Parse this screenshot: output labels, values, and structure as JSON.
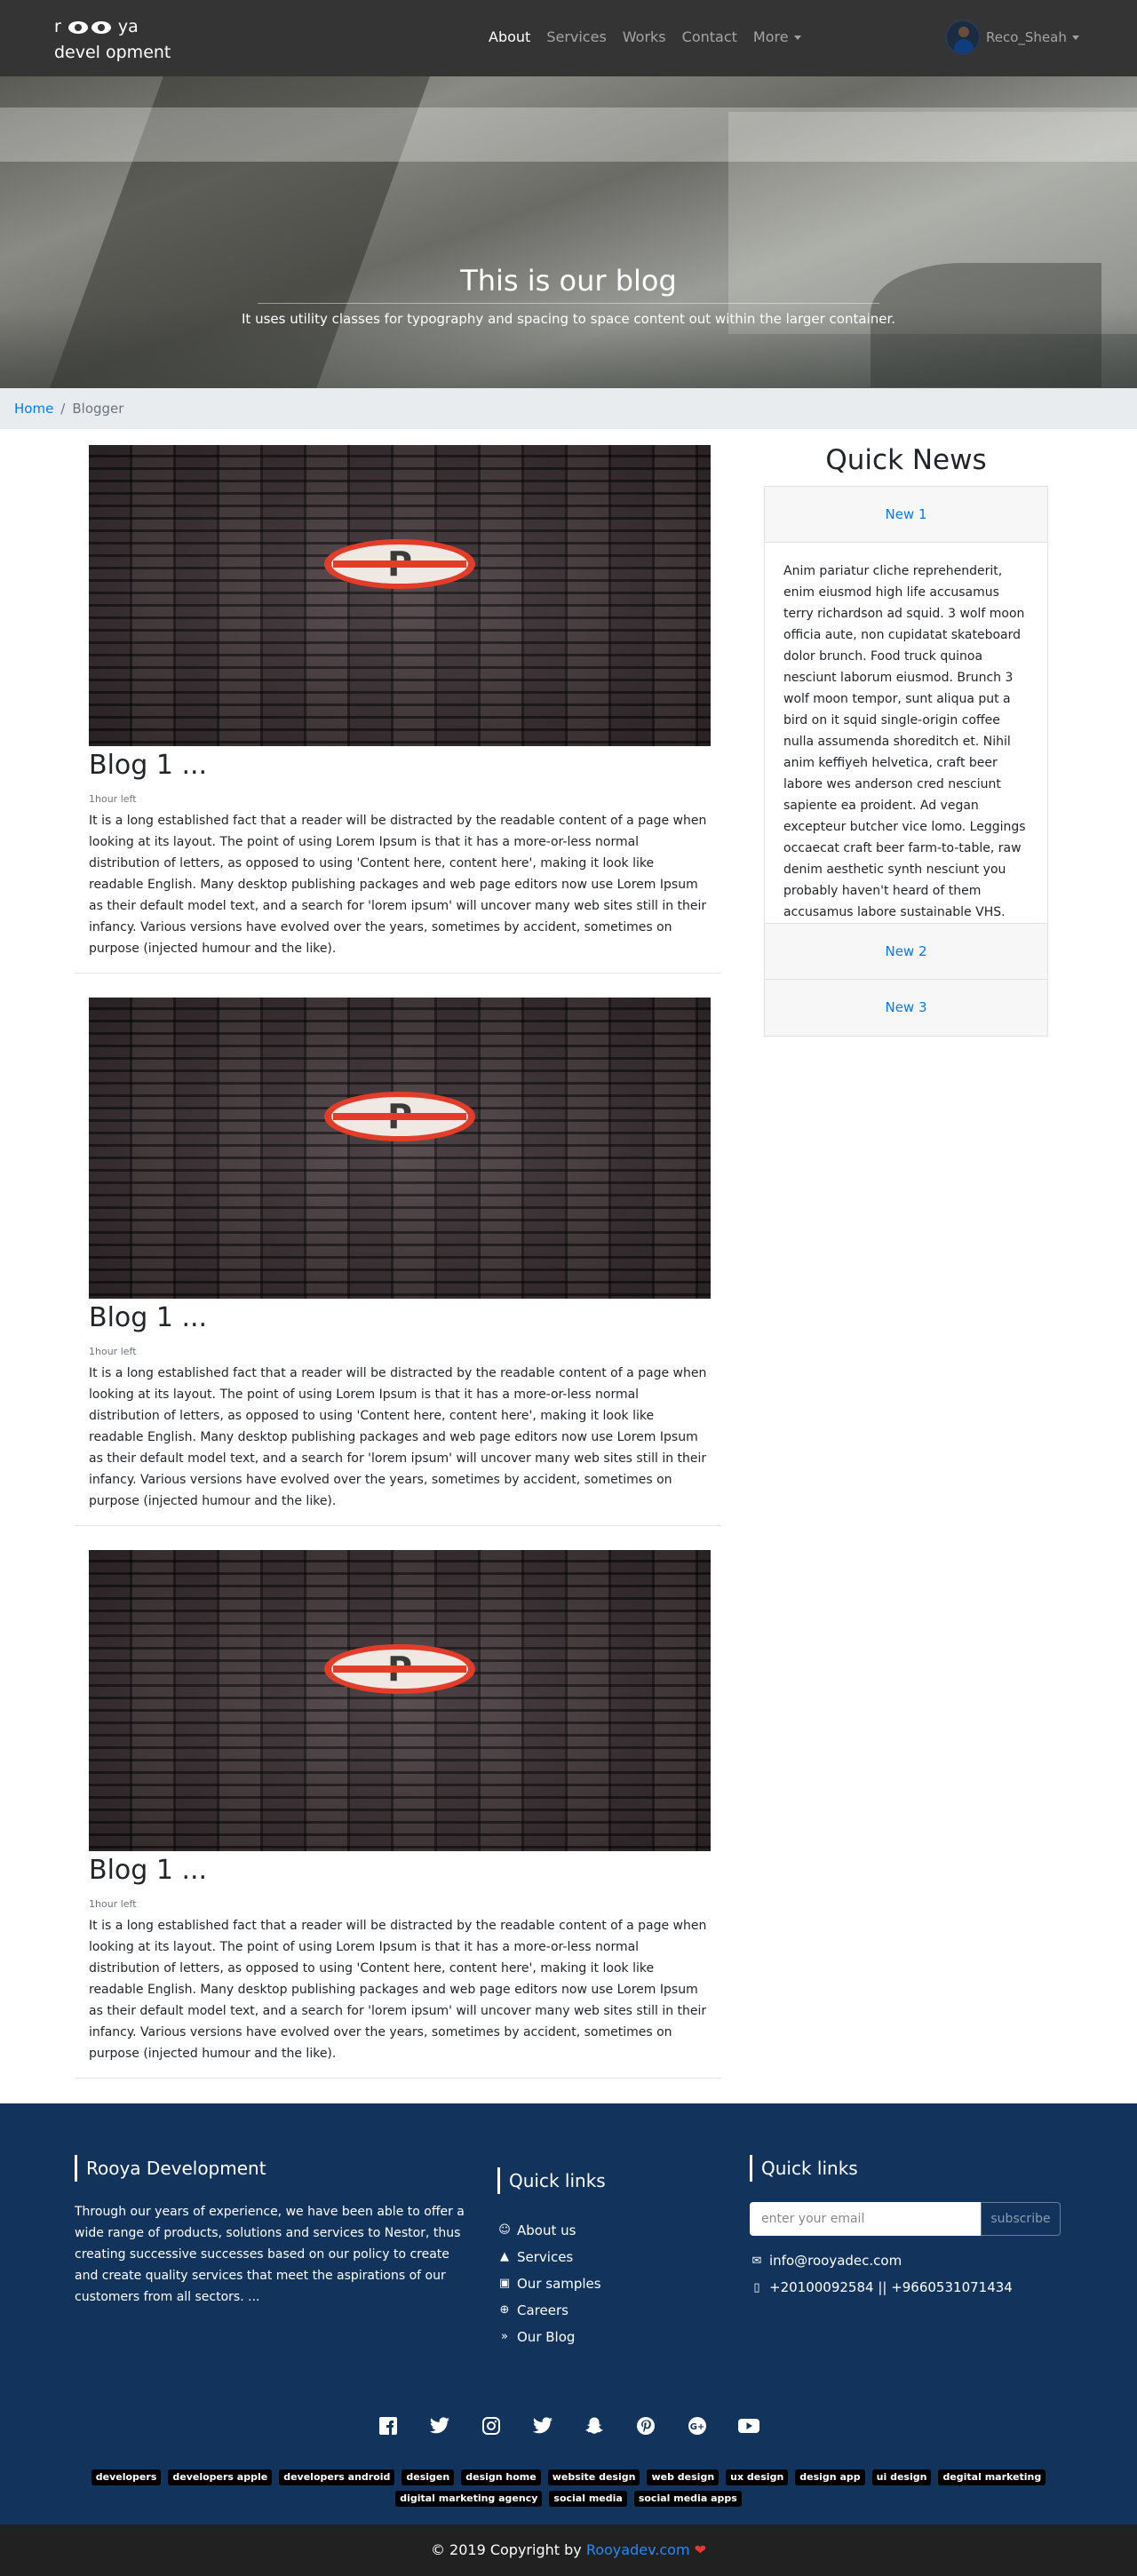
{
  "brand": {
    "line1_a": "r",
    "line1_b": "ya",
    "line2": "devel opment"
  },
  "nav": {
    "items": [
      {
        "label": "About"
      },
      {
        "label": "Services"
      },
      {
        "label": "Works"
      },
      {
        "label": "Contact"
      },
      {
        "label": "More"
      }
    ],
    "user_name": "Reco_Sheah"
  },
  "hero": {
    "title": "This is our blog",
    "subtitle": "It uses utility classes for typography and spacing to space content out within the larger container."
  },
  "breadcrumb": {
    "home": "Home",
    "separator": "/",
    "current": "Blogger"
  },
  "posts": [
    {
      "title": "Blog 1 ...",
      "time": "1hour left",
      "text": "It is a long established fact that a reader will be distracted by the readable content of a page when looking at its layout. The point of using Lorem Ipsum is that it has a more-or-less normal distribution of letters, as opposed to using 'Content here, content here', making it look like readable English. Many desktop publishing packages and web page editors now use Lorem Ipsum as their default model text, and a search for 'lorem ipsum' will uncover many web sites still in their infancy. Various versions have evolved over the years, sometimes by accident, sometimes on purpose (injected humour and the like).",
      "sign_letter": "P"
    },
    {
      "title": "Blog 1 ...",
      "time": "1hour left",
      "text": "It is a long established fact that a reader will be distracted by the readable content of a page when looking at its layout. The point of using Lorem Ipsum is that it has a more-or-less normal distribution of letters, as opposed to using 'Content here, content here', making it look like readable English. Many desktop publishing packages and web page editors now use Lorem Ipsum as their default model text, and a search for 'lorem ipsum' will uncover many web sites still in their infancy. Various versions have evolved over the years, sometimes by accident, sometimes on purpose (injected humour and the like).",
      "sign_letter": "P"
    },
    {
      "title": "Blog 1 ...",
      "time": "1hour left",
      "text": "It is a long established fact that a reader will be distracted by the readable content of a page when looking at its layout. The point of using Lorem Ipsum is that it has a more-or-less normal distribution of letters, as opposed to using 'Content here, content here', making it look like readable English. Many desktop publishing packages and web page editors now use Lorem Ipsum as their default model text, and a search for 'lorem ipsum' will uncover many web sites still in their infancy. Various versions have evolved over the years, sometimes by accident, sometimes on purpose (injected humour and the like).",
      "sign_letter": "P"
    }
  ],
  "quick_news": {
    "title": "Quick News",
    "items": [
      {
        "label": "New 1"
      },
      {
        "label": "New 2"
      },
      {
        "label": "New 3"
      }
    ],
    "body": "Anim pariatur cliche reprehenderit, enim eiusmod high life accusamus terry richardson ad squid. 3 wolf moon officia aute, non cupidatat skateboard dolor brunch. Food truck quinoa nesciunt laborum eiusmod. Brunch 3 wolf moon tempor, sunt aliqua put a bird on it squid single-origin coffee nulla assumenda shoreditch et. Nihil anim keffiyeh helvetica, craft beer labore wes anderson cred nesciunt sapiente ea proident. Ad vegan excepteur butcher vice lomo. Leggings occaecat craft beer farm-to-table, raw denim aesthetic synth nesciunt you probably haven't heard of them accusamus labore sustainable VHS."
  },
  "footer": {
    "about_title": "Rooya Development",
    "about_text": "Through our years of experience, we have been able to offer a wide range of products, solutions and services to Nestor, thus creating successive successes based on our policy to create and create quality services that meet the aspirations of our customers from all sectors. ...",
    "links_title": "Quick links",
    "links": [
      {
        "label": "About us",
        "icon": "users-icon"
      },
      {
        "label": "Services",
        "icon": "bell-icon"
      },
      {
        "label": "Our samples",
        "icon": "briefcase-icon"
      },
      {
        "label": "Careers",
        "icon": "search-plus-icon"
      },
      {
        "label": "Our Blog",
        "icon": "double-chevron-icon"
      }
    ],
    "contact_title": "Quick links",
    "email_placeholder": "enter your email",
    "subscribe_label": "subscribe",
    "email": "info@rooyadec.com",
    "phone": "+20100092584 || +9660531071434",
    "socials": [
      "facebook-icon",
      "twitter-icon",
      "instagram-icon",
      "twitter-icon",
      "snapchat-icon",
      "pinterest-icon",
      "google-plus-icon",
      "youtube-icon"
    ],
    "tags": [
      "developers",
      "developers apple",
      "developers android",
      "desigen",
      "design home",
      "website design",
      "web design",
      "ux design",
      "design app",
      "ui design",
      "degital marketing",
      "digital marketing agency",
      "social media",
      "social media apps"
    ]
  },
  "copyright": {
    "prefix": "© 2019 Copyright by",
    "brand": "Rooyadev.com"
  },
  "colors": {
    "navbar": "#343434",
    "footer": "#12335c",
    "link": "#007bff",
    "copyright_bg": "#212121"
  }
}
